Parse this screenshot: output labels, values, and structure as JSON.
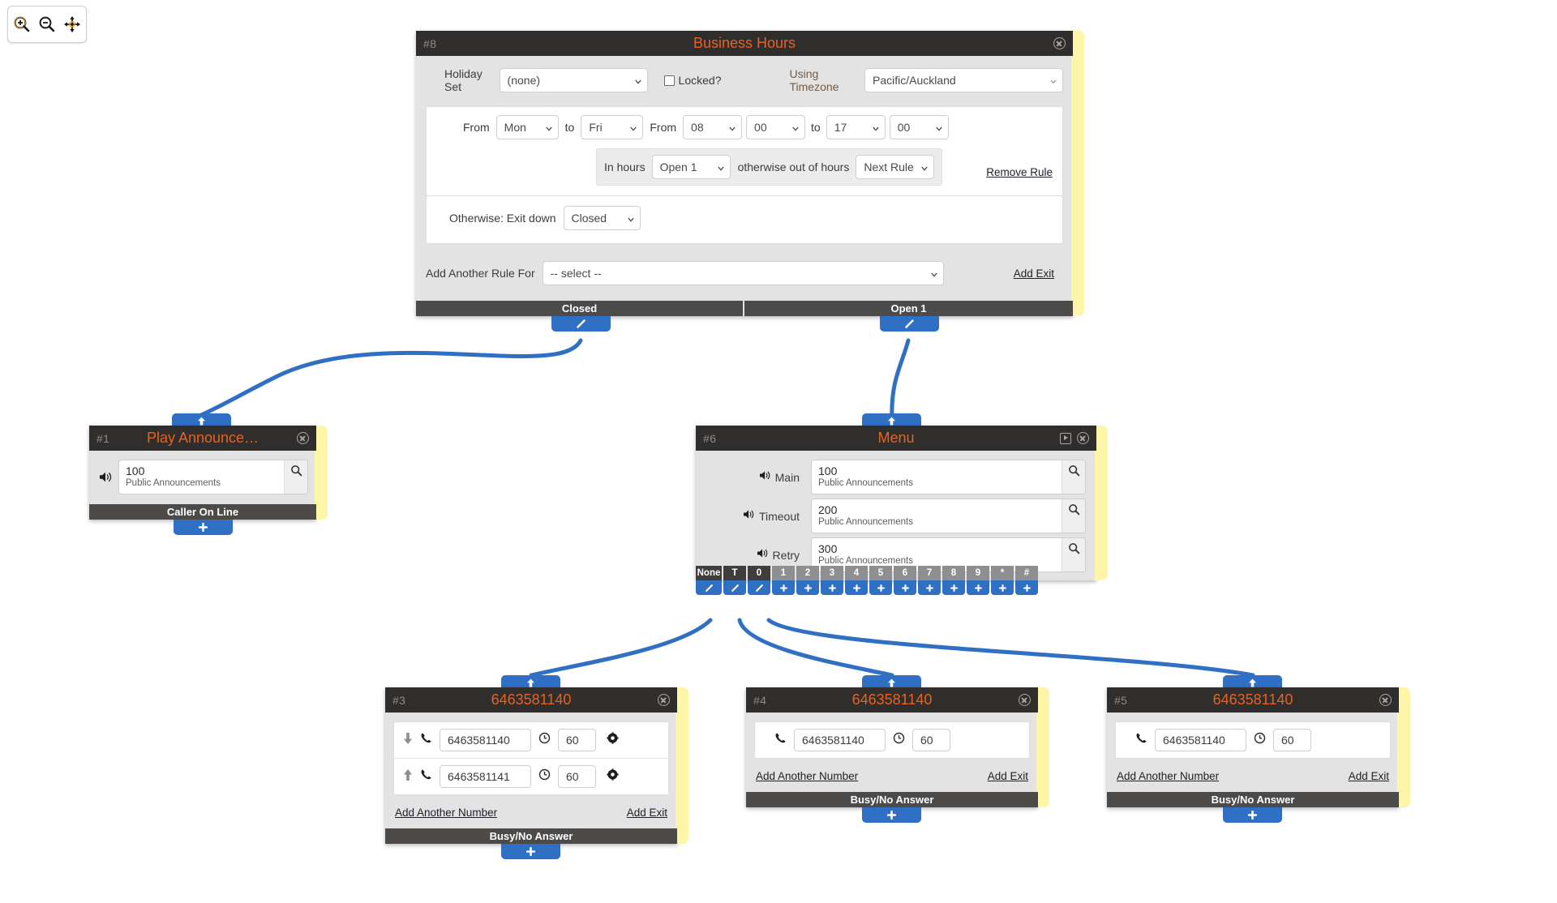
{
  "toolbar": {
    "zoom_in": "zoom-in",
    "zoom_out": "zoom-out",
    "pan": "pan-move"
  },
  "nodes": {
    "business_hours": {
      "id": "#8",
      "title": "Business Hours",
      "holiday_set_label": "Holiday Set",
      "holiday_set_value": "(none)",
      "locked_label": "Locked?",
      "locked_checked": false,
      "timezone_label": "Using Timezone",
      "timezone_value": "Pacific/Auckland",
      "rule": {
        "from_label": "From",
        "day_from": "Mon",
        "to_label": "to",
        "day_to": "Fri",
        "from_time_label": "From",
        "hour_from": "08",
        "minute_from": "00",
        "to_time_label": "to",
        "hour_to": "17",
        "minute_to": "00",
        "in_hours_label": "In hours",
        "in_hours_value": "Open 1",
        "otherwise_label": "otherwise out of hours",
        "otherwise_value": "Next Rule",
        "remove_rule": "Remove Rule"
      },
      "otherwise_exit_label": "Otherwise: Exit down",
      "otherwise_exit_value": "Closed",
      "add_rule_label": "Add Another Rule For",
      "add_rule_value": "-- select --",
      "add_exit": "Add Exit",
      "exits": [
        "Closed",
        "Open 1"
      ]
    },
    "play_announcement": {
      "id": "#1",
      "title": "Play Announce…",
      "announcement": {
        "number": "100",
        "name": "Public Announcements"
      },
      "exits": [
        "Caller On Line"
      ]
    },
    "menu": {
      "id": "#6",
      "title": "Menu",
      "prompts": [
        {
          "label": "Main",
          "number": "100",
          "name": "Public Announcements"
        },
        {
          "label": "Timeout",
          "number": "200",
          "name": "Public Announcements"
        },
        {
          "label": "Retry",
          "number": "300",
          "name": "Public Announcements"
        }
      ],
      "keys": [
        "None",
        "T",
        "0",
        "1",
        "2",
        "3",
        "4",
        "5",
        "6",
        "7",
        "8",
        "9",
        "*",
        "#"
      ],
      "keys_connected": [
        "None",
        "T",
        "0"
      ]
    },
    "dest3": {
      "id": "#3",
      "title": "6463581140",
      "rows": [
        {
          "direction": "down",
          "number": "6463581140",
          "timeout": "60",
          "has_settings": true
        },
        {
          "direction": "up",
          "number": "6463581141",
          "timeout": "60",
          "has_settings": true
        }
      ],
      "add_number": "Add Another Number",
      "add_exit": "Add Exit",
      "exits": [
        "Busy/No Answer"
      ]
    },
    "dest4": {
      "id": "#4",
      "title": "6463581140",
      "rows": [
        {
          "direction": "none",
          "number": "6463581140",
          "timeout": "60",
          "has_settings": false
        }
      ],
      "add_number": "Add Another Number",
      "add_exit": "Add Exit",
      "exits": [
        "Busy/No Answer"
      ]
    },
    "dest5": {
      "id": "#5",
      "title": "6463581140",
      "rows": [
        {
          "direction": "none",
          "number": "6463581140",
          "timeout": "60",
          "has_settings": false
        }
      ],
      "add_number": "Add Another Number",
      "add_exit": "Add Exit",
      "exits": [
        "Busy/No Answer"
      ]
    }
  },
  "colors": {
    "accent_orange": "#e8621f",
    "header_dark": "#302e2d",
    "exit_bar": "#4d4b49",
    "tab_blue": "#2f6fc4",
    "wire_blue": "#2f6fc4",
    "sticky_yellow": "#fdf6a8"
  }
}
